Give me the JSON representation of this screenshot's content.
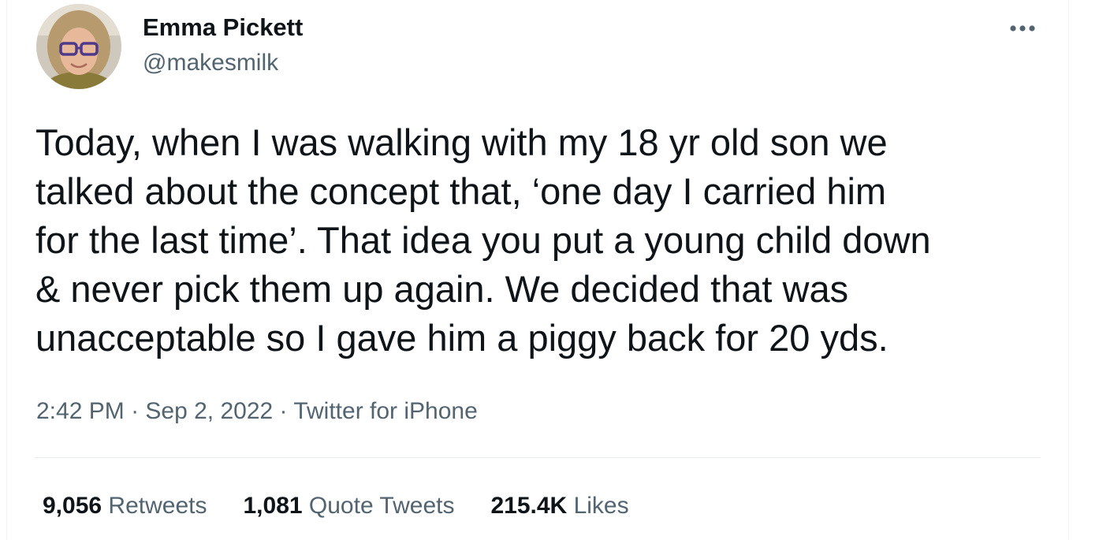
{
  "tweet": {
    "author": {
      "name": "Emma Pickett",
      "handle": "@makesmilk"
    },
    "more_icon": "more-horizontal-icon",
    "text": "Today, when I was walking with my 18 yr old son we\ntalked about the concept that, ‘one day I carried him\nfor the last time’. That idea you put a young child down\n& never pick them up again. We decided that was\nunacceptable so I gave him a piggy back for 20 yds.",
    "time": "2:42 PM",
    "separator": " · ",
    "date": "Sep 2, 2022",
    "source": "Twitter for iPhone",
    "stats": {
      "retweets": {
        "count": "9,056",
        "label": "Retweets"
      },
      "quote_tweets": {
        "count": "1,081",
        "label": "Quote Tweets"
      },
      "likes": {
        "count": "215.4K",
        "label": "Likes"
      }
    }
  },
  "colors": {
    "primary_text": "#0f1419",
    "secondary_text": "#536471",
    "divider": "#e6ecf0"
  }
}
